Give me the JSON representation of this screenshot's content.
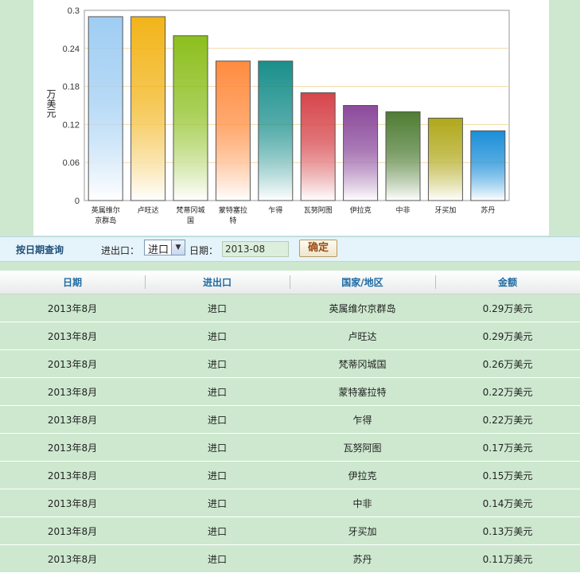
{
  "chart_data": {
    "type": "bar",
    "ylabel": "万美元",
    "ylim": [
      0,
      0.3
    ],
    "yticks": [
      "0",
      "0.06",
      "0.12",
      "0.18",
      "0.24",
      "0.3"
    ],
    "categories": [
      "英属维尔京群岛",
      "卢旺达",
      "梵蒂冈城国",
      "蒙特塞拉特",
      "乍得",
      "瓦努阿图",
      "伊拉克",
      "中非",
      "牙买加",
      "苏丹"
    ],
    "tick_labels": [
      [
        "英属维尔",
        "京群岛"
      ],
      [
        "卢旺达"
      ],
      [
        "梵蒂冈城",
        "国"
      ],
      [
        "蒙特塞拉",
        "特"
      ],
      [
        "乍得"
      ],
      [
        "瓦努阿图"
      ],
      [
        "伊拉克"
      ],
      [
        "中非"
      ],
      [
        "牙买加"
      ],
      [
        "苏丹"
      ]
    ],
    "values": [
      0.29,
      0.29,
      0.26,
      0.22,
      0.22,
      0.17,
      0.15,
      0.14,
      0.13,
      0.11
    ],
    "colors": [
      "#9fcdf3",
      "#f2b419",
      "#8cbf1e",
      "#ff8c3f",
      "#1a8f8c",
      "#d6454a",
      "#8b4a9c",
      "#4f7d35",
      "#b0a81a",
      "#1b8ed8"
    ],
    "grid": true,
    "legend": "none"
  },
  "query": {
    "title": "按日期查询",
    "type_label": "进出口：",
    "type_value": "进口",
    "date_label": "日期：",
    "date_value": "2013-08",
    "submit_label": "确定"
  },
  "table": {
    "headers": [
      "日期",
      "进出口",
      "国家/地区",
      "金额"
    ],
    "rows": [
      [
        "2013年8月",
        "进口",
        "英属维尔京群岛",
        "0.29万美元"
      ],
      [
        "2013年8月",
        "进口",
        "卢旺达",
        "0.29万美元"
      ],
      [
        "2013年8月",
        "进口",
        "梵蒂冈城国",
        "0.26万美元"
      ],
      [
        "2013年8月",
        "进口",
        "蒙特塞拉特",
        "0.22万美元"
      ],
      [
        "2013年8月",
        "进口",
        "乍得",
        "0.22万美元"
      ],
      [
        "2013年8月",
        "进口",
        "瓦努阿图",
        "0.17万美元"
      ],
      [
        "2013年8月",
        "进口",
        "伊拉克",
        "0.15万美元"
      ],
      [
        "2013年8月",
        "进口",
        "中非",
        "0.14万美元"
      ],
      [
        "2013年8月",
        "进口",
        "牙买加",
        "0.13万美元"
      ],
      [
        "2013年8月",
        "进口",
        "苏丹",
        "0.11万美元"
      ]
    ]
  }
}
